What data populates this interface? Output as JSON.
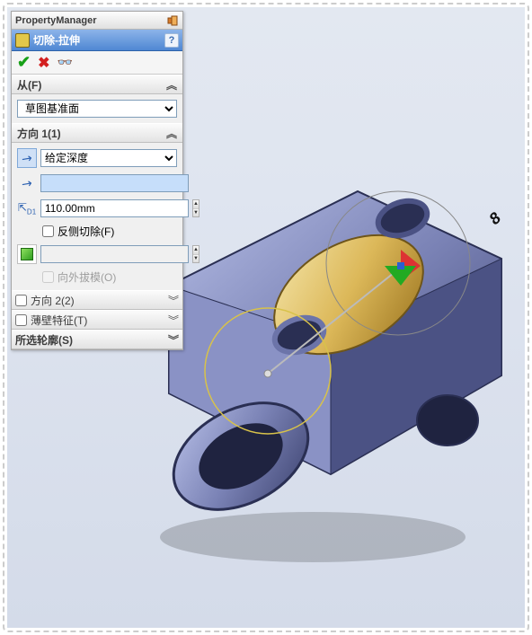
{
  "titlebar": {
    "title": "PropertyManager"
  },
  "feature": {
    "name": "切除-拉伸"
  },
  "sections": {
    "from": {
      "title": "从(F)",
      "option_selected": "草图基准面",
      "options": [
        "草图基准面"
      ]
    },
    "dir1": {
      "title": "方向 1(1)",
      "end_condition": "给定深度",
      "end_options": [
        "给定深度"
      ],
      "value_field": "",
      "depth": "110.00mm",
      "flip_label": "反侧切除(F)",
      "draft_label": "向外拔模(O)"
    },
    "dir2": {
      "title": "方向 2(2)"
    },
    "thin": {
      "title": "薄壁特征(T)"
    },
    "contours": {
      "title": "所选轮廓(S)"
    }
  },
  "viewport": {
    "dim_label": "8"
  }
}
